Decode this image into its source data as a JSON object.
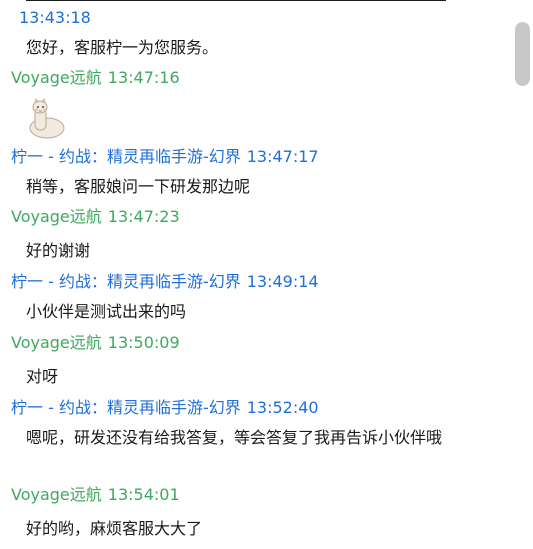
{
  "messages": [
    {
      "sender": "",
      "time": "13:43:18",
      "role": "service",
      "text": "您好，客服柠一为您服务。"
    },
    {
      "sender": "Voyage远航",
      "time": "13:47:16",
      "role": "customer",
      "sticker": "alpaca-sticker"
    },
    {
      "sender": "柠一 - 约战：精灵再临手游-幻界",
      "time": "13:47:17",
      "role": "service",
      "text": "稍等，客服娘问一下研发那边呢"
    },
    {
      "sender": "Voyage远航",
      "time": "13:47:23",
      "role": "customer",
      "text": "好的谢谢"
    },
    {
      "sender": "柠一 - 约战：精灵再临手游-幻界",
      "time": "13:49:14",
      "role": "service",
      "text": "小伙伴是测试出来的吗"
    },
    {
      "sender": "Voyage远航",
      "time": "13:50:09",
      "role": "customer",
      "text": "对呀"
    },
    {
      "sender": "柠一 - 约战：精灵再临手游-幻界",
      "time": "13:52:40",
      "role": "service",
      "text": "嗯呢，研发还没有给我答复，等会答复了我再告诉小伙伴哦"
    },
    {
      "sender": "Voyage远航",
      "time": "13:54:01",
      "role": "customer",
      "text": "好的哟，麻烦客服大大了"
    }
  ],
  "colors": {
    "service": "#1e6fd9",
    "customer": "#3daa5e",
    "text": "#1a1a1a"
  }
}
